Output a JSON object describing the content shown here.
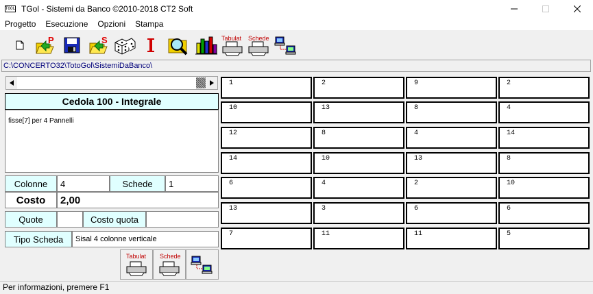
{
  "window": {
    "title": "TGol - Sistemi da Banco ©2010-2018 CT2 Soft",
    "icon_text": "TGOL"
  },
  "menu": [
    "Progetto",
    "Esecuzione",
    "Opzioni",
    "Stampa"
  ],
  "toolbar": {
    "tabulat_label": "Tabulat",
    "schede_label": "Schede"
  },
  "path": "C:\\CONCERTO32\\TotoGol\\SistemiDaBanco\\",
  "cedola": {
    "title": "Cedola 100 - Integrale",
    "description": "fisse[7] per 4 Pannelli",
    "colonne_label": "Colonne",
    "colonne_value": "4",
    "schede_label": "Schede",
    "schede_value": "1",
    "costo_label": "Costo",
    "costo_value": "2,00",
    "quote_label": "Quote",
    "quote_value": "",
    "costo_quota_label": "Costo quota",
    "costo_quota_value": "",
    "tipo_label": "Tipo Scheda",
    "tipo_value": "Sisal 4 colonne verticale"
  },
  "print_group": {
    "tabulat_label": "Tabulat",
    "schede_label": "Schede"
  },
  "grid": [
    [
      "1",
      "2",
      "9",
      "2"
    ],
    [
      "10",
      "13",
      "8",
      "4"
    ],
    [
      "12",
      "8",
      "4",
      "14"
    ],
    [
      "14",
      "10",
      "13",
      "8"
    ],
    [
      "6",
      "4",
      "2",
      "10"
    ],
    [
      "13",
      "3",
      "6",
      "6"
    ],
    [
      "7",
      "11",
      "11",
      "5"
    ]
  ],
  "status": "Per informazioni, premere F1"
}
